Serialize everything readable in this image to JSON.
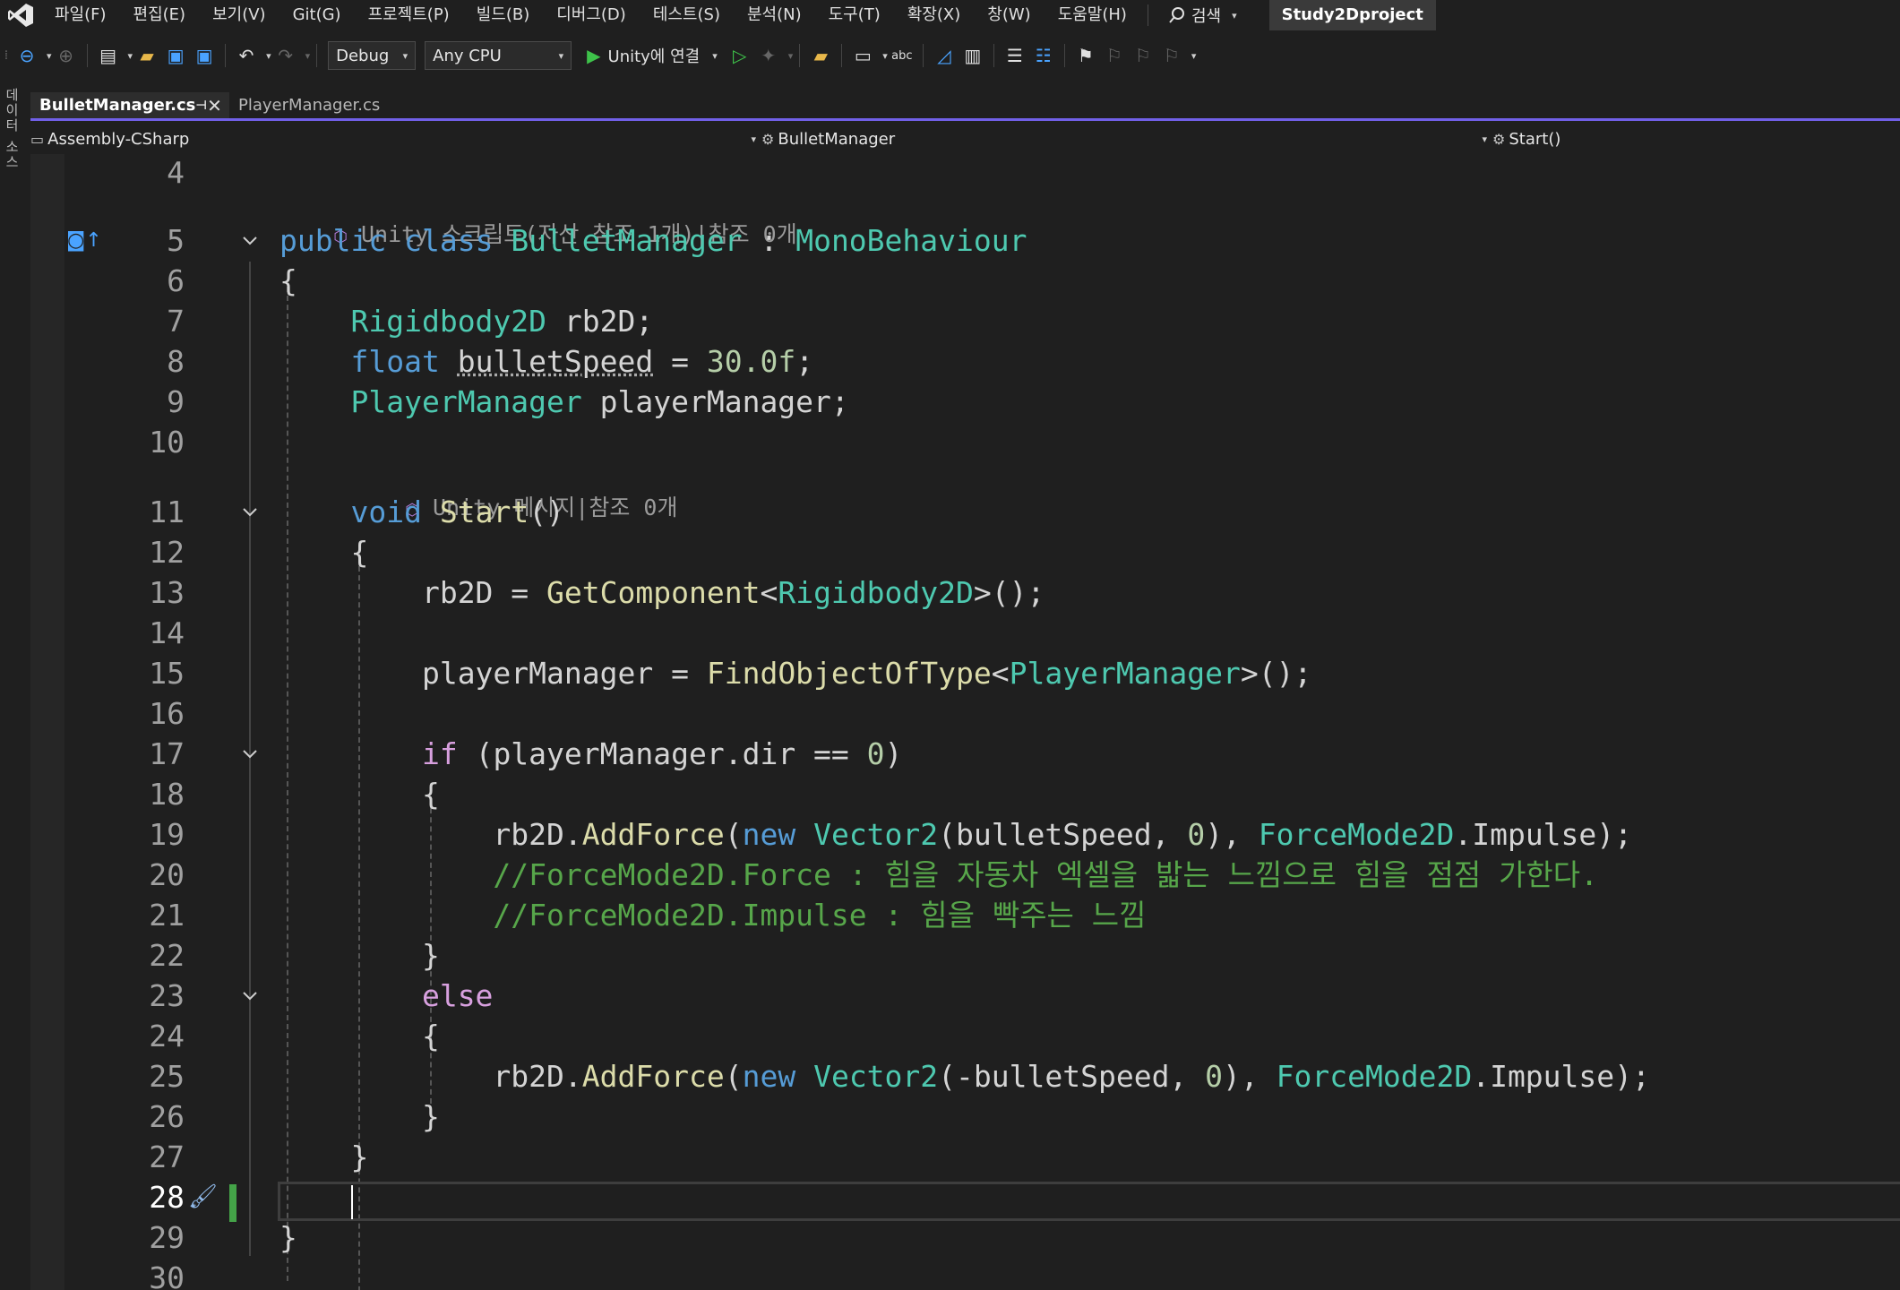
{
  "menubar": {
    "items": [
      "파일(F)",
      "편집(E)",
      "보기(V)",
      "Git(G)",
      "프로젝트(P)",
      "빌드(B)",
      "디버그(D)",
      "테스트(S)",
      "분석(N)",
      "도구(T)",
      "확장(X)",
      "창(W)",
      "도움말(H)"
    ],
    "search_label": "검색",
    "solution_name": "Study2Dproject"
  },
  "toolbar": {
    "configuration": "Debug",
    "platform": "Any CPU",
    "run_label": "Unity에 연결"
  },
  "side_strip": {
    "label": "데이터 소스"
  },
  "tabs": [
    {
      "label": "BulletManager.cs",
      "active": true
    },
    {
      "label": "PlayerManager.cs",
      "active": false
    }
  ],
  "navbar": {
    "project": "Assembly-CSharp",
    "type": "BulletManager",
    "member": "Start()"
  },
  "editor": {
    "current_line": "28",
    "codelens_class": "Unity 스크립트(자산 참조 1개)|참조 0개",
    "codelens_method": "Unity 메시지|참조 0개",
    "line_numbers": [
      "4",
      "5",
      "6",
      "7",
      "8",
      "9",
      "10",
      "11",
      "12",
      "13",
      "14",
      "15",
      "16",
      "17",
      "18",
      "19",
      "20",
      "21",
      "22",
      "23",
      "24",
      "25",
      "26",
      "27",
      "28",
      "29",
      "30"
    ],
    "code": {
      "l5_public": "public",
      "l5_class": "class",
      "l5_name": "BulletManager",
      "l5_colon": " : ",
      "l5_base": "MonoBehaviour",
      "l6": "{",
      "l7_type": "Rigidbody2D",
      "l7_rest": " rb2D;",
      "l8_type": "float",
      "l8_var": "bulletSpeed",
      "l8_eq": " = ",
      "l8_num": "30.0f",
      "l8_semi": ";",
      "l9_type": "PlayerManager",
      "l9_rest": " playerManager;",
      "l11_void": "void",
      "l11_name": "Start",
      "l11_rest": "()",
      "l12": "{",
      "l13_lhs": "rb2D = ",
      "l13_fn": "GetComponent",
      "l13_lt": "<",
      "l13_type": "Rigidbody2D",
      "l13_rest": ">();",
      "l15_lhs": "playerManager = ",
      "l15_fn": "FindObjectOfType",
      "l15_lt": "<",
      "l15_type": "PlayerManager",
      "l15_rest": ">();",
      "l17_if": "if",
      "l17_rest1": " (playerManager.dir == ",
      "l17_num": "0",
      "l17_rest2": ")",
      "l18": "{",
      "l19_a": "rb2D.",
      "l19_fn": "AddForce",
      "l19_b": "(",
      "l19_new": "new",
      "l19_sp": " ",
      "l19_type": "Vector2",
      "l19_c": "(bulletSpeed, ",
      "l19_num": "0",
      "l19_d": "), ",
      "l19_type2": "ForceMode2D",
      "l19_e": ".Impulse);",
      "l20": "//ForceMode2D.Force : 힘을 자동차 엑셀을 밟는 느낌으로 힘을 점점 가한다.",
      "l21": "//ForceMode2D.Impulse : 힘을 빡주는 느낌",
      "l22": "}",
      "l23_else": "else",
      "l24": "{",
      "l25_a": "rb2D.",
      "l25_fn": "AddForce",
      "l25_b": "(",
      "l25_new": "new",
      "l25_sp": " ",
      "l25_type": "Vector2",
      "l25_c": "(-bulletSpeed, ",
      "l25_num": "0",
      "l25_d": "), ",
      "l25_type2": "ForceMode2D",
      "l25_e": ".Impulse);",
      "l26": "}",
      "l27": "}",
      "l29": "}"
    }
  },
  "colors": {
    "accent": "#7160e8",
    "keyword": "#569cd6",
    "type": "#4ec9b0",
    "method": "#dcdcaa",
    "number": "#b5cea8",
    "comment": "#57a64a",
    "control": "#d8a0df"
  }
}
